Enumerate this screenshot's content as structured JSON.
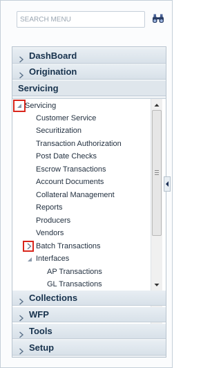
{
  "search": {
    "placeholder": "SEARCH MENU",
    "value": ""
  },
  "accordion": {
    "dashboard": "DashBoard",
    "origination": "Origination",
    "servicing": "Servicing",
    "collections": "Collections",
    "wfp": "WFP",
    "tools": "Tools",
    "setup": "Setup"
  },
  "tree": {
    "root": "Servicing",
    "items": [
      "Customer Service",
      "Securitization",
      "Transaction Authorization",
      "Post Date Checks",
      "Escrow Transactions",
      "Account Documents",
      "Collateral Management",
      "Reports",
      "Producers",
      "Vendors"
    ],
    "batch": "Batch Transactions",
    "interfaces": "Interfaces",
    "interface_items": [
      "AP Transactions",
      "GL Transactions"
    ]
  },
  "icons": {
    "search": "binoculars-icon",
    "collapsed": "chevron-right-icon",
    "expanded": "triangle-down-icon",
    "highlight_color": "#d9261c"
  }
}
